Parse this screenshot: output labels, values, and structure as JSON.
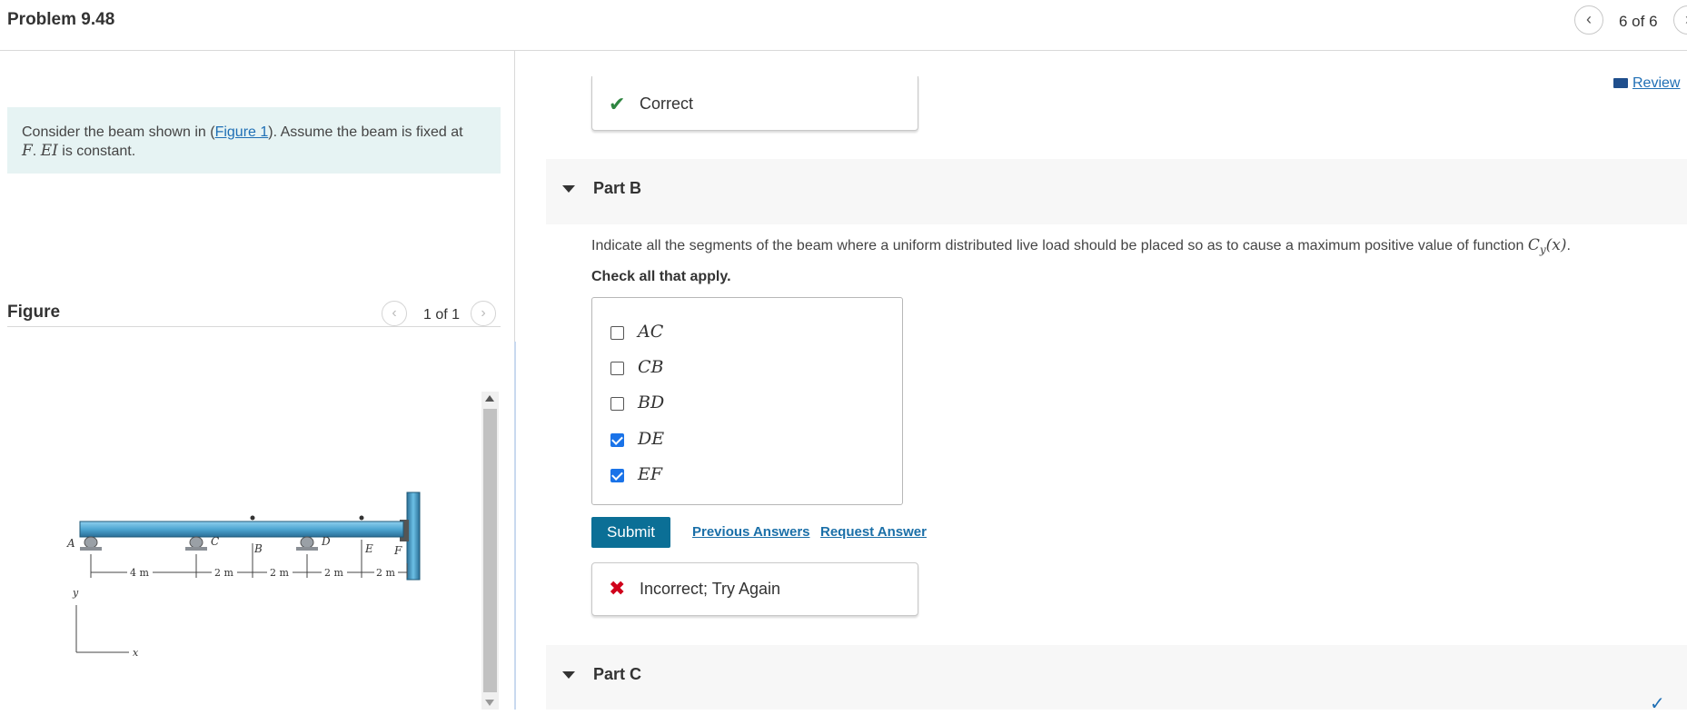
{
  "header": {
    "title": "Problem 9.48",
    "pager_prev_icon": "chevron-left-icon",
    "pager_count": "6 of 6",
    "pager_next_icon": "chevron-right-icon"
  },
  "left": {
    "intro_prefix": "Consider the beam shown in (",
    "intro_link": "Figure 1",
    "intro_mid": "). Assume the beam is fixed at",
    "intro_F": "F",
    "intro_period": ". ",
    "intro_EI": "EI",
    "intro_suffix": " is constant.",
    "figure_title": "Figure",
    "figure_count": "1 of 1",
    "figure_prev_icon": "chevron-left-icon",
    "figure_next_icon": "chevron-right-icon",
    "diagram": {
      "points": [
        "A",
        "C",
        "B",
        "D",
        "E",
        "F"
      ],
      "dimensions": [
        "4 m",
        "2 m",
        "2 m",
        "2 m",
        "2 m"
      ],
      "axis_y": "y",
      "axis_x": "x",
      "colors": {
        "beam": "#4ea6d2",
        "beam_dark": "#2a6e96",
        "support": "#8a8f95",
        "wall": "#4ea6d2"
      }
    }
  },
  "right": {
    "review_label": "Review",
    "review_icon": "book-icon",
    "correct_icon": "checkmark-icon",
    "correct_text": "Correct",
    "part_b_label": "Part B",
    "question_text": "Indicate all the segments of the beam where a uniform distributed live load should be placed so as to cause a maximum positive value of function",
    "question_func": "C",
    "question_sub": "y",
    "question_arg": "(x)",
    "question_end": ".",
    "check_all": "Check all that apply.",
    "options": [
      {
        "label": "AC",
        "checked": false
      },
      {
        "label": "CB",
        "checked": false
      },
      {
        "label": "BD",
        "checked": false
      },
      {
        "label": "DE",
        "checked": true
      },
      {
        "label": "EF",
        "checked": true
      }
    ],
    "submit_label": "Submit",
    "previous_answers": "Previous Answers",
    "request_answer": "Request Answer",
    "incorrect_icon": "x-icon",
    "incorrect_text": "Incorrect; Try Again",
    "part_c_label": "Part C",
    "part_caret_icon": "caret-down-icon",
    "colors": {
      "correct": "#2e8540",
      "incorrect": "#d0021b",
      "submit": "#0b6f96",
      "link": "#1a6fa8",
      "part_bg": "#f7f7f7"
    }
  }
}
